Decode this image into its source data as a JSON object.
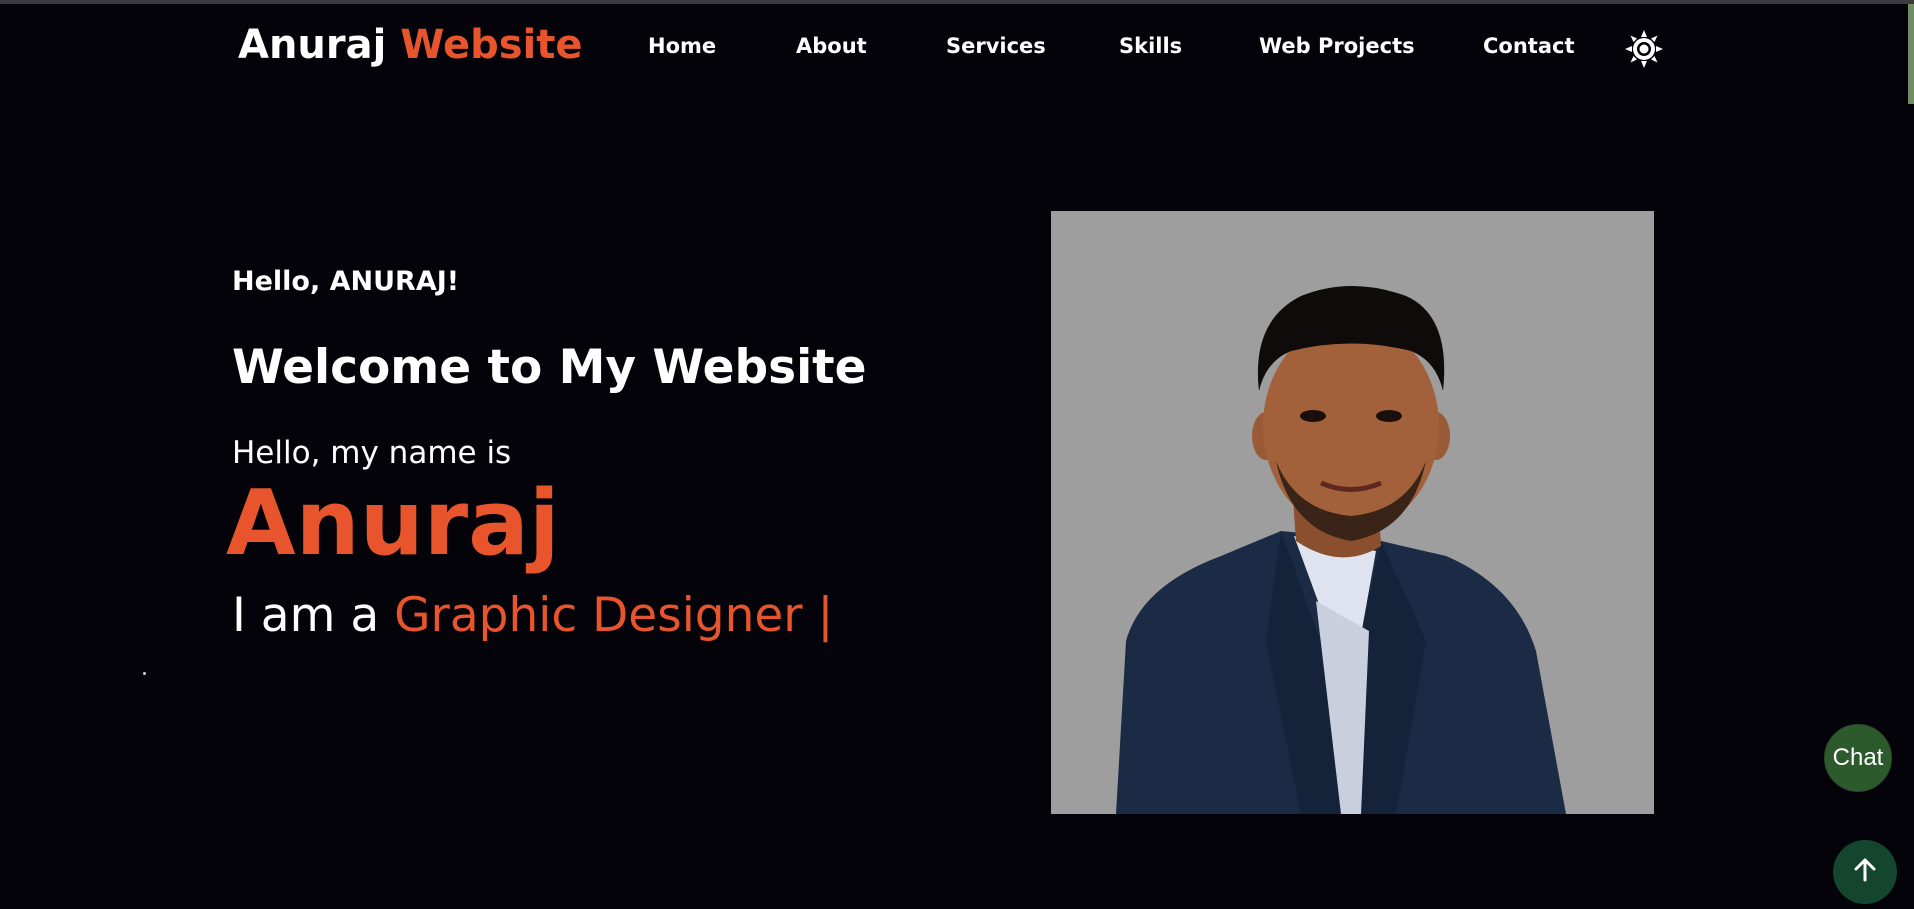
{
  "header": {
    "brand_first": "Anuraj",
    "brand_second": "Website",
    "nav": [
      "Home",
      "About",
      "Services",
      "Skills",
      "Web Projects",
      "Contact"
    ],
    "theme_toggle_icon": "sun-icon"
  },
  "hero": {
    "greeting": "Hello, ANURAJ!",
    "welcome": "Welcome to My Website",
    "intro": "Hello, my name is",
    "name": "Anuraj",
    "role_prefix": "I am a",
    "role": "Graphic Designer |",
    "photo_icon": "profile-photo"
  },
  "floating": {
    "chat_label": "Chat",
    "scroll_top_icon": "arrow-up-icon"
  },
  "colors": {
    "background": "#030309",
    "accent": "#e8552d",
    "chat_button": "#2d5a2d",
    "scroll_top_button": "#14452f",
    "photo_background": "#9e9e9e"
  }
}
